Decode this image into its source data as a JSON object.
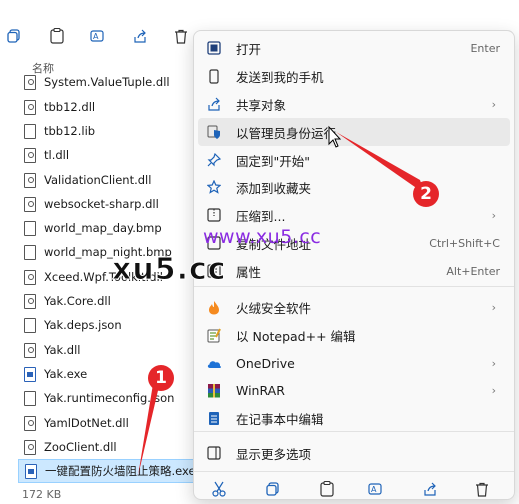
{
  "explorer": {
    "column_header": "名称",
    "files": [
      {
        "name": "System.ValueTuple.dll",
        "type": "dll"
      },
      {
        "name": "tbb12.dll",
        "type": "dll"
      },
      {
        "name": "tbb12.lib",
        "type": "file"
      },
      {
        "name": "tl.dll",
        "type": "dll"
      },
      {
        "name": "ValidationClient.dll",
        "type": "dll"
      },
      {
        "name": "websocket-sharp.dll",
        "type": "dll"
      },
      {
        "name": "world_map_day.bmp",
        "type": "bmp"
      },
      {
        "name": "world_map_night.bmp",
        "type": "bmp"
      },
      {
        "name": "Xceed.Wpf.Toolkit.dll",
        "type": "dll"
      },
      {
        "name": "Yak.Core.dll",
        "type": "dll"
      },
      {
        "name": "Yak.deps.json",
        "type": "file"
      },
      {
        "name": "Yak.dll",
        "type": "dll"
      },
      {
        "name": "Yak.exe",
        "type": "exe"
      },
      {
        "name": "Yak.runtimeconfig.json",
        "type": "file"
      },
      {
        "name": "YamlDotNet.dll",
        "type": "dll"
      },
      {
        "name": "ZooClient.dll",
        "type": "dll"
      },
      {
        "name": "一键配置防火墙阻止策略.exe",
        "type": "exe"
      }
    ],
    "status": "172 KB",
    "toolbar_icons": [
      "copy-icon",
      "paste-icon",
      "rename-icon",
      "share-icon",
      "delete-icon"
    ]
  },
  "context_menu": {
    "items": [
      {
        "label": "打开",
        "shortcut": "Enter",
        "icon": "open-icon"
      },
      {
        "label": "发送到我的手机",
        "shortcut": "",
        "icon": "phone-icon"
      },
      {
        "label": "共享对象",
        "shortcut": "",
        "icon": "share-icon",
        "submenu": true
      },
      {
        "label": "以管理员身份运行",
        "shortcut": "",
        "icon": "shield-icon"
      },
      {
        "label": "固定到\"开始\"",
        "shortcut": "",
        "icon": "pin-icon"
      },
      {
        "label": "添加到收藏夹",
        "shortcut": "",
        "icon": "star-icon"
      },
      {
        "label": "压缩到...",
        "shortcut": "",
        "icon": "zip-icon",
        "submenu": true
      },
      {
        "label": "复制文件地址",
        "shortcut": "Ctrl+Shift+C",
        "icon": "path-icon"
      },
      {
        "label": "属性",
        "shortcut": "Alt+Enter",
        "icon": "properties-icon"
      },
      {
        "label": "火绒安全软件",
        "shortcut": "",
        "icon": "huorong-icon",
        "submenu": true
      },
      {
        "label": "以 Notepad++ 编辑",
        "shortcut": "",
        "icon": "notepadpp-icon"
      },
      {
        "label": "OneDrive",
        "shortcut": "",
        "icon": "onedrive-icon",
        "submenu": true
      },
      {
        "label": "WinRAR",
        "shortcut": "",
        "icon": "winrar-icon",
        "submenu": true
      },
      {
        "label": "在记事本中编辑",
        "shortcut": "",
        "icon": "notepad-icon"
      },
      {
        "label": "显示更多选项",
        "shortcut": "",
        "icon": "more-options-icon"
      }
    ],
    "bottom_icons": [
      "cut-icon",
      "copy-icon",
      "paste-icon",
      "rename-icon",
      "share-icon",
      "delete-icon"
    ]
  },
  "watermarks": {
    "url": "www.xu5.cc",
    "big": "xu5.cc"
  },
  "annotations": {
    "badge1": "1",
    "badge2": "2"
  }
}
